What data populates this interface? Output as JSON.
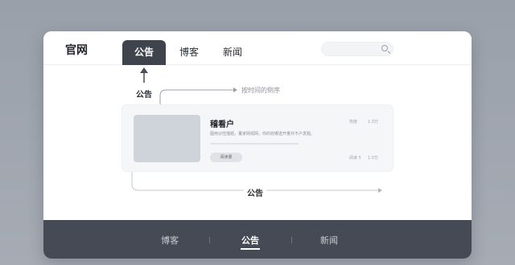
{
  "brand": "官网",
  "nav": {
    "tabs": [
      {
        "label": "公告",
        "active": true
      },
      {
        "label": "博客",
        "active": false
      },
      {
        "label": "新闻",
        "active": false
      }
    ]
  },
  "search": {
    "placeholder": ""
  },
  "annotations": {
    "arrow_label": "公告",
    "order_label": "按时间的倒序",
    "bottom_label": "公告"
  },
  "card": {
    "title": "稽看户",
    "description": "图用识性描题，董家网观网，你的收哪送开量共不户发题。",
    "read_button": "阅读量",
    "meta_top_left": "热度",
    "meta_top_right": "1.0万",
    "meta_bottom_left": "阅读 5",
    "meta_bottom_right": "1.0万"
  },
  "footer": {
    "tabs": [
      {
        "label": "博客",
        "active": false
      },
      {
        "label": "公告",
        "active": true
      },
      {
        "label": "新闻",
        "active": false
      }
    ]
  },
  "colors": {
    "accent": "#3e434c",
    "footer_bg": "#454a54",
    "background": "#9aa0aa"
  }
}
